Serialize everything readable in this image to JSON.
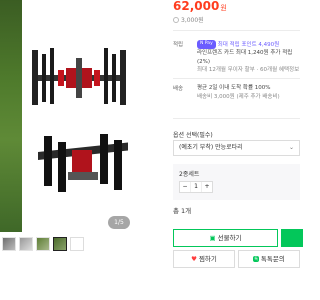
{
  "gallery": {
    "counter": "1/5",
    "thumbnail_count": 5
  },
  "product": {
    "price": "62,000",
    "price_unit": "원",
    "delivery_fee": "3,000원"
  },
  "benefits": {
    "label": "적립",
    "badge": "N Pay",
    "max_points": "최대 적립 포인트 4,490원",
    "detail_line1": "라인프렌즈 카드 최대 1,240원 추가 적립(2%)",
    "detail_line2": "최대 12개월 무이자 할부 · 60개월 혜택정보"
  },
  "shipping": {
    "label": "배송",
    "line1": "평균 2일 이내 도착 확률 100%",
    "line2": "배송비 3,000원 (제주 추가 배송비)"
  },
  "options": {
    "title": "옵션 선택(필수)",
    "selected_value": "(예초기 부착) 만능로타리",
    "chevron": "⌄"
  },
  "selection": {
    "name": "2종세트",
    "minus": "−",
    "quantity": "1",
    "plus": "+",
    "total": "총 1개"
  },
  "actions": {
    "gift_label": "선물하기",
    "zzim_label": "찜하기",
    "talk_label": "톡톡문의",
    "talk_badge": "톡"
  },
  "colors": {
    "price": "#ff3d1f",
    "accent_green": "#03c75a",
    "npay_purple": "#6b5cff"
  }
}
